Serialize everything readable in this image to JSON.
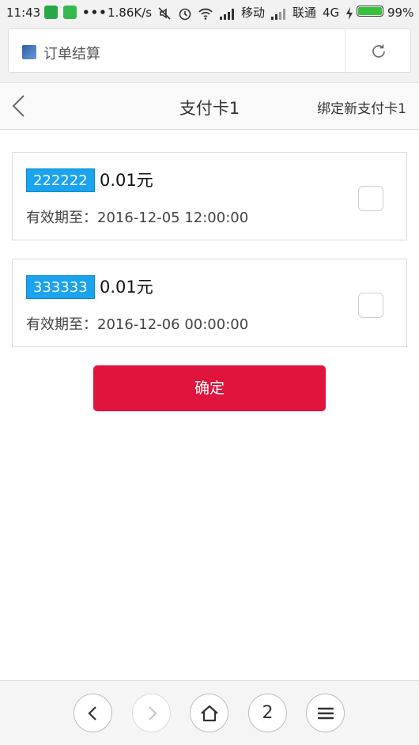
{
  "status_bar": {
    "time": "11:43",
    "dots": "•••",
    "net_speed": "1.86K/s",
    "carrier1": "移动",
    "carrier2": "联通",
    "network": "4G",
    "battery_pct": "99%",
    "battery_level": 0.99
  },
  "browser": {
    "page_title": "订单结算"
  },
  "header": {
    "title": "支付卡1",
    "action": "绑定新支付卡1"
  },
  "cards": [
    {
      "code": "222222",
      "amount": "0.01元",
      "expiry": "有效期至：2016-12-05 12:00:00",
      "checked": false
    },
    {
      "code": "333333",
      "amount": "0.01元",
      "expiry": "有效期至：2016-12-06 00:00:00",
      "checked": false
    }
  ],
  "confirm_label": "确定",
  "bottom_nav": {
    "tab_count": "2"
  },
  "colors": {
    "accent": "#e0143c",
    "code_badge": "#1aa3ee"
  }
}
